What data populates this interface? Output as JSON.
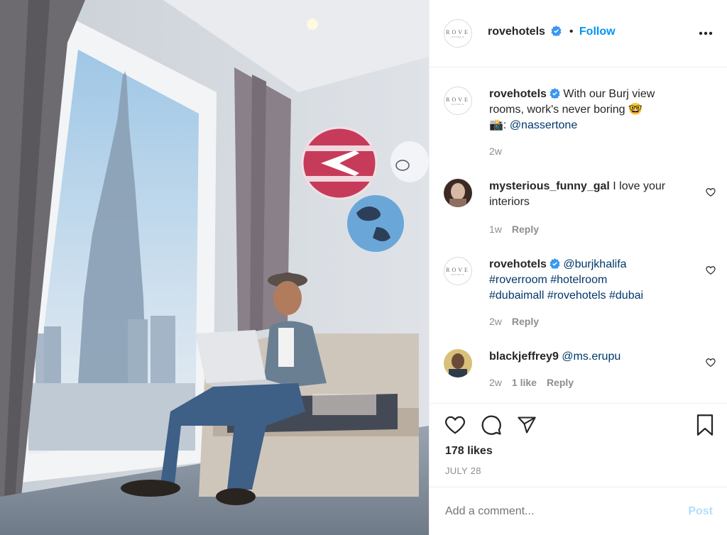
{
  "post": {
    "username": "rovehotels",
    "follow_label": "Follow",
    "separator": "•",
    "avatar_logo_text": "ROVE",
    "avatar_logo_sub": "HOTELS"
  },
  "caption": {
    "username": "rovehotels",
    "text_line1": "With our Burj view",
    "text_line2": "rooms, work's never boring 🤓",
    "text_line3_prefix": "📸: ",
    "mention": "@nassertone",
    "time": "2w"
  },
  "comments": [
    {
      "username": "mysterious_funny_gal",
      "text_line1": "I love your",
      "text_line2": "interiors",
      "time": "1w",
      "reply_label": "Reply"
    },
    {
      "username": "rovehotels",
      "mention": "@burjkhalifa",
      "tags_line2": "#roverroom #hotelroom",
      "tags_line3": "#dubaimall #rovehotels #dubai",
      "time": "2w",
      "reply_label": "Reply"
    },
    {
      "username": "blackjeffrey9",
      "mention": "@ms.erupu",
      "time": "2w",
      "likes": "1 like",
      "reply_label": "Reply"
    }
  ],
  "actions": {
    "likes": "178 likes",
    "date": "JULY 28"
  },
  "comment_box": {
    "placeholder": "Add a comment...",
    "post_label": "Post"
  },
  "colors": {
    "accent": "#0095f6",
    "link": "#00376b",
    "muted": "#8e8e8e",
    "verified": "#3897f0"
  },
  "icons": {
    "more": "more-icon",
    "heart": "heart-icon",
    "comment": "comment-icon",
    "share": "share-icon",
    "save": "bookmark-icon",
    "verified": "verified-badge-icon"
  }
}
